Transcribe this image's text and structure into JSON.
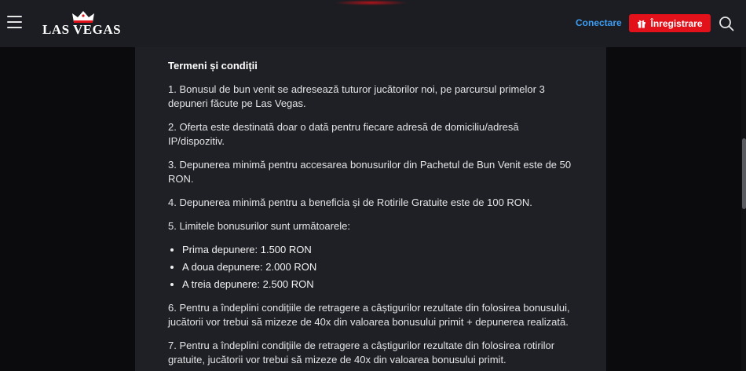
{
  "header": {
    "logo_text": "LAS VEGAS",
    "login_label": "Conectare",
    "register_label": "Înregistrare",
    "icons": {
      "menu": "hamburger-menu-icon",
      "crown": "crown-icon",
      "gift": "gift-icon",
      "search": "search-icon"
    }
  },
  "colors": {
    "accent_red": "#e3121a",
    "link_blue": "#3d9df2",
    "panel_bg": "#1e2025",
    "header_bg": "#1b1d22"
  },
  "terms": {
    "title": "Termeni și condiții",
    "p1": "1. Bonusul de bun venit se adresează tuturor jucătorilor noi, pe parcursul primelor 3 depuneri făcute pe Las Vegas.",
    "p2": "2. Oferta este destinată doar o dată pentru fiecare adresă de domiciliu/adresă IP/dispozitiv.",
    "p3": "3. Depunerea minimă pentru accesarea bonusurilor din Pachetul de Bun Venit este de 50 RON.",
    "p4": "4. Depunerea minimă pentru a beneficia și de Rotirile Gratuite este de 100 RON.",
    "p5": "5. Limitele bonusurilor sunt următoarele:",
    "limits": [
      "Prima depunere: 1.500 RON",
      "A doua depunere: 2.000 RON",
      "A treia depunere: 2.500 RON"
    ],
    "p6": "6. Pentru a îndeplini condițiile de retragere a câștigurilor rezultate din folosirea bonusului, jucătorii vor trebui să mizeze de 40x din valoarea bonusului primit + depunerea realizată.",
    "p7": "7. Pentru a îndeplini condițiile de retragere a câștigurilor rezultate din folosirea rotirilor gratuite, jucătorii vor trebui să mizeze de 40x din valoarea bonusului primit."
  }
}
